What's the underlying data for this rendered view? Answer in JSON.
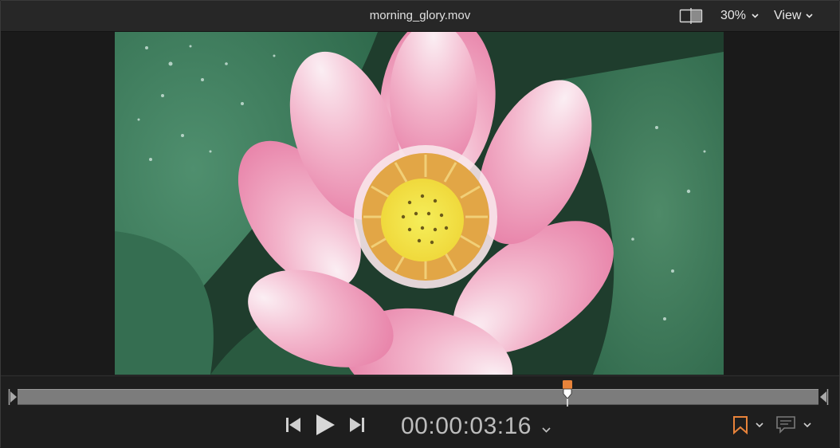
{
  "window": {
    "title": "morning_glory.mov"
  },
  "toolbar": {
    "zoom_label": "30%",
    "view_label": "View"
  },
  "playback": {
    "timecode": "00:00:03:16",
    "playhead_position_fraction": 0.687
  },
  "colors": {
    "marker_accent": "#e8833a",
    "playhead_head": "#e8833a"
  },
  "icons": {
    "compare": "compare-viewer-icon",
    "prev": "go-to-start-icon",
    "play": "play-icon",
    "next": "go-to-end-icon",
    "bookmark": "bookmark-icon",
    "caption": "caption-icon"
  }
}
